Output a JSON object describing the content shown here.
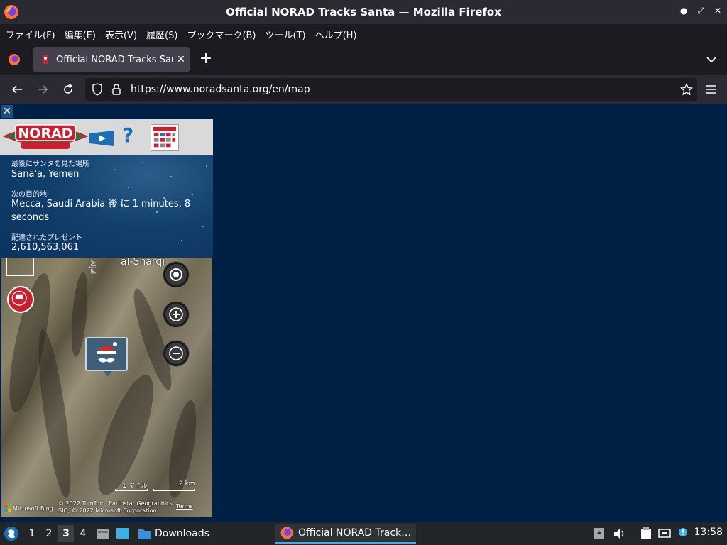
{
  "window": {
    "title": "Official NORAD Tracks Santa — Mozilla Firefox"
  },
  "menu": {
    "items": [
      "ファイル(F)",
      "編集(E)",
      "表示(V)",
      "履歴(S)",
      "ブックマーク(B)",
      "ツール(T)",
      "ヘルプ(H)"
    ]
  },
  "tabs": [
    {
      "label": "Official NORAD Tracks Santa"
    }
  ],
  "navbar": {
    "url": "https://www.noradsanta.org/en/map"
  },
  "panel": {
    "last_seen_label": "最後にサンタを見た場所",
    "last_seen_value": "Sana'a, Yemen",
    "next_stop_label": "次の目的地",
    "next_stop_value": "Mecca, Saudi Arabia 後 に 1 minutes, 8 seconds",
    "presents_label": "配達されたプレゼント",
    "presents_value": "2,610,563,061"
  },
  "map": {
    "city_label": "al-Sharqi",
    "road_label": "Aljalh",
    "scale_miles": "1 マイル",
    "scale_km": "2 km",
    "attribution": "© 2022 TomTom, Earthstar Geographics SIO, © 2022 Microsoft Corporation",
    "terms": "Terms",
    "provider": "Microsoft Bing"
  },
  "taskbar": {
    "workspaces": [
      "1",
      "2",
      "3",
      "4"
    ],
    "active_workspace": "3",
    "downloads_label": "Downloads",
    "task_label": "Official NORAD Track…",
    "clock": "13:58"
  },
  "colors": {
    "content_bg": "#002145",
    "accent": "#3daee9",
    "tracker_red": "#c8202f"
  }
}
